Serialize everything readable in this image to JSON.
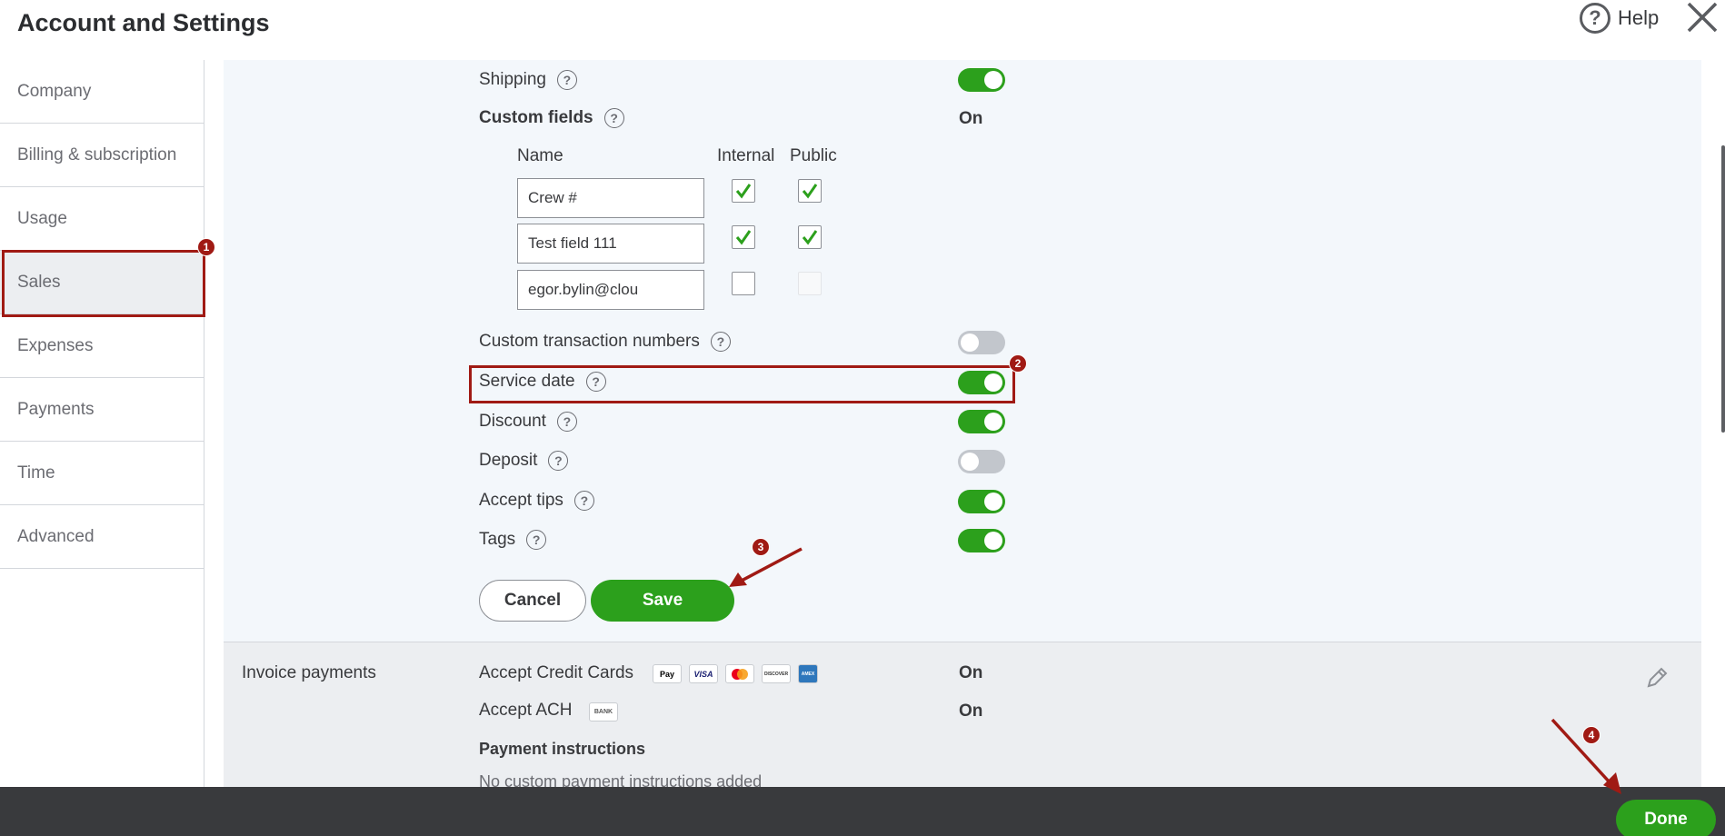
{
  "header": {
    "title": "Account and Settings",
    "help_label": "Help"
  },
  "sidebar": {
    "items": [
      {
        "label": "Company"
      },
      {
        "label": "Billing & subscription"
      },
      {
        "label": "Usage"
      },
      {
        "label": "Sales"
      },
      {
        "label": "Expenses"
      },
      {
        "label": "Payments"
      },
      {
        "label": "Time"
      },
      {
        "label": "Advanced"
      }
    ]
  },
  "sales_form": {
    "shipping": {
      "label": "Shipping",
      "enabled": true
    },
    "custom_fields": {
      "label": "Custom fields",
      "status": "On",
      "col_name": "Name",
      "col_internal": "Internal",
      "col_public": "Public",
      "rows": [
        {
          "value": "Crew #",
          "internal": true,
          "public": true
        },
        {
          "value": "Test field 111",
          "internal": true,
          "public": true
        },
        {
          "value": "egor.bylin@clou",
          "internal": false,
          "public": false
        }
      ]
    },
    "custom_transaction_numbers": {
      "label": "Custom transaction numbers",
      "enabled": false
    },
    "service_date": {
      "label": "Service date",
      "enabled": true
    },
    "discount": {
      "label": "Discount",
      "enabled": true
    },
    "deposit": {
      "label": "Deposit",
      "enabled": false
    },
    "accept_tips": {
      "label": "Accept tips",
      "enabled": true
    },
    "tags": {
      "label": "Tags",
      "enabled": true
    },
    "cancel_label": "Cancel",
    "save_label": "Save"
  },
  "invoice_payments": {
    "section_label": "Invoice payments",
    "credit_cards": {
      "label": "Accept Credit Cards",
      "status": "On"
    },
    "ach": {
      "label": "Accept ACH",
      "status": "On",
      "badge": "BANK"
    },
    "payment_instructions_label": "Payment instructions",
    "payment_instructions_value": "No custom payment instructions added",
    "card_icons": [
      "Pay",
      "VISA",
      "mastercard",
      "DISCOVER",
      "AMEX"
    ]
  },
  "footer": {
    "done_label": "Done"
  },
  "annotations": {
    "badges": [
      "1",
      "2",
      "3",
      "4"
    ]
  },
  "colors": {
    "accent_green": "#2ca01c",
    "annotation_red": "#a01a14",
    "footer_bg": "#393a3d"
  }
}
